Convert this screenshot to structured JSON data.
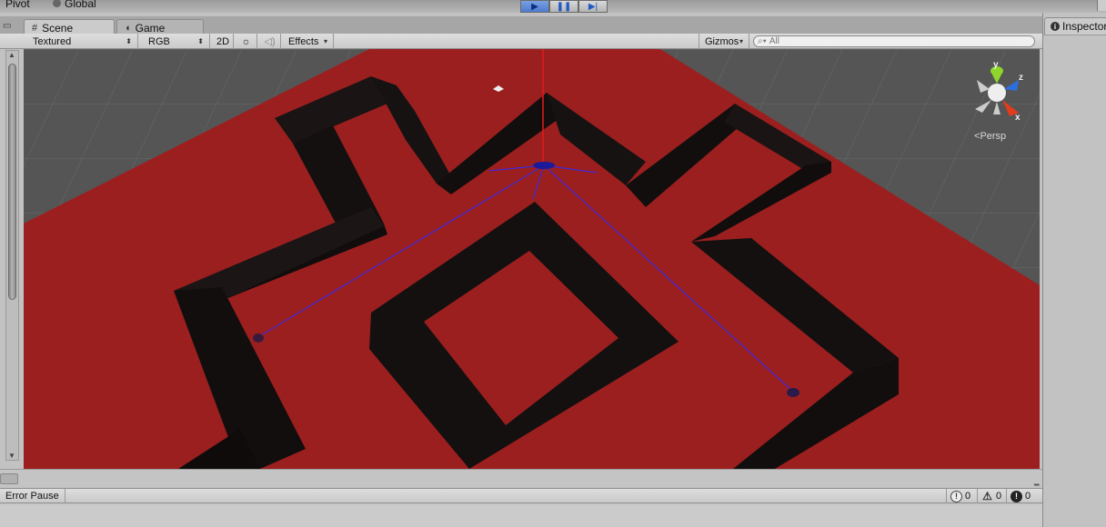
{
  "toolbar_top": {
    "pivot_label": "Pivot",
    "global_label": "Global"
  },
  "tabs": {
    "scene_label": "Scene",
    "game_label": "Game"
  },
  "scene_toolbar": {
    "shading_mode": "Textured",
    "render_mode": "RGB",
    "mode_2d": "2D",
    "effects_label": "Effects",
    "gizmos_label": "Gizmos",
    "search_placeholder": "All"
  },
  "scene_view": {
    "projection_label": "Persp",
    "gizmo_axes": [
      "y",
      "z",
      "x"
    ],
    "colors": {
      "floor": "#9c1f1f",
      "walls": "#141010",
      "grid_bg": "#555555",
      "path_lines": "#1a1aff",
      "x_axis": "#e23b1e",
      "y_axis": "#8fd62a",
      "z_axis": "#2d6fe0"
    }
  },
  "console": {
    "error_pause_label": "Error Pause",
    "info_count": "0",
    "warning_count": "0",
    "error_count": "0"
  },
  "inspector": {
    "tab_label": "Inspector"
  }
}
